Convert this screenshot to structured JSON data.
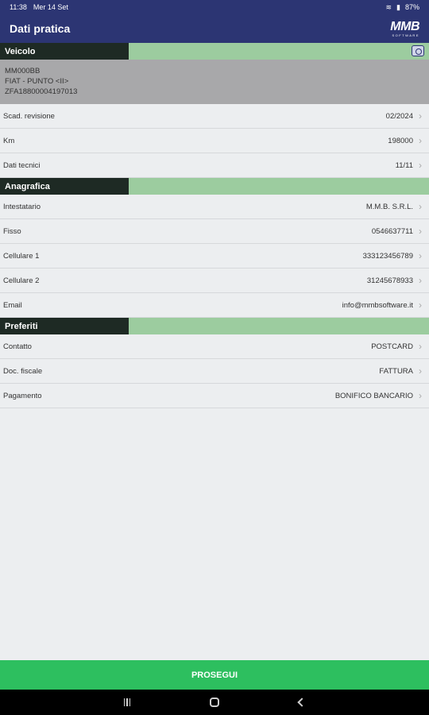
{
  "status": {
    "time": "11:38",
    "date": "Mer 14 Set",
    "battery": "87%"
  },
  "appbar": {
    "title": "Dati pratica",
    "logo_text": "MMB",
    "logo_sub": "SOFTWARE"
  },
  "vehicle": {
    "section_label": "Veicolo",
    "plate": "MM000BB",
    "model": "FIAT - PUNTO <II>",
    "vin": "ZFA18800004197013",
    "rows": [
      {
        "label": "Scad. revisione",
        "value": "02/2024"
      },
      {
        "label": "Km",
        "value": "198000"
      },
      {
        "label": "Dati tecnici",
        "value": "11/11"
      }
    ]
  },
  "anagrafica": {
    "section_label": "Anagrafica",
    "rows": [
      {
        "label": "Intestatario",
        "value": "M.M.B. S.R.L."
      },
      {
        "label": "Fisso",
        "value": "0546637711"
      },
      {
        "label": "Cellulare 1",
        "value": "333123456789"
      },
      {
        "label": "Cellulare 2",
        "value": "31245678933"
      },
      {
        "label": "Email",
        "value": "info@mmbsoftware.it"
      }
    ]
  },
  "preferiti": {
    "section_label": "Preferiti",
    "rows": [
      {
        "label": "Contatto",
        "value": "POSTCARD"
      },
      {
        "label": "Doc. fiscale",
        "value": "FATTURA"
      },
      {
        "label": "Pagamento",
        "value": "BONIFICO BANCARIO"
      }
    ]
  },
  "footer": {
    "button_label": "PROSEGUI",
    "button_color": "#2dbf5f"
  },
  "colors": {
    "primary": "#2c3573",
    "section_bg": "#9ccc9f",
    "section_label_bg": "#1e2a24"
  }
}
